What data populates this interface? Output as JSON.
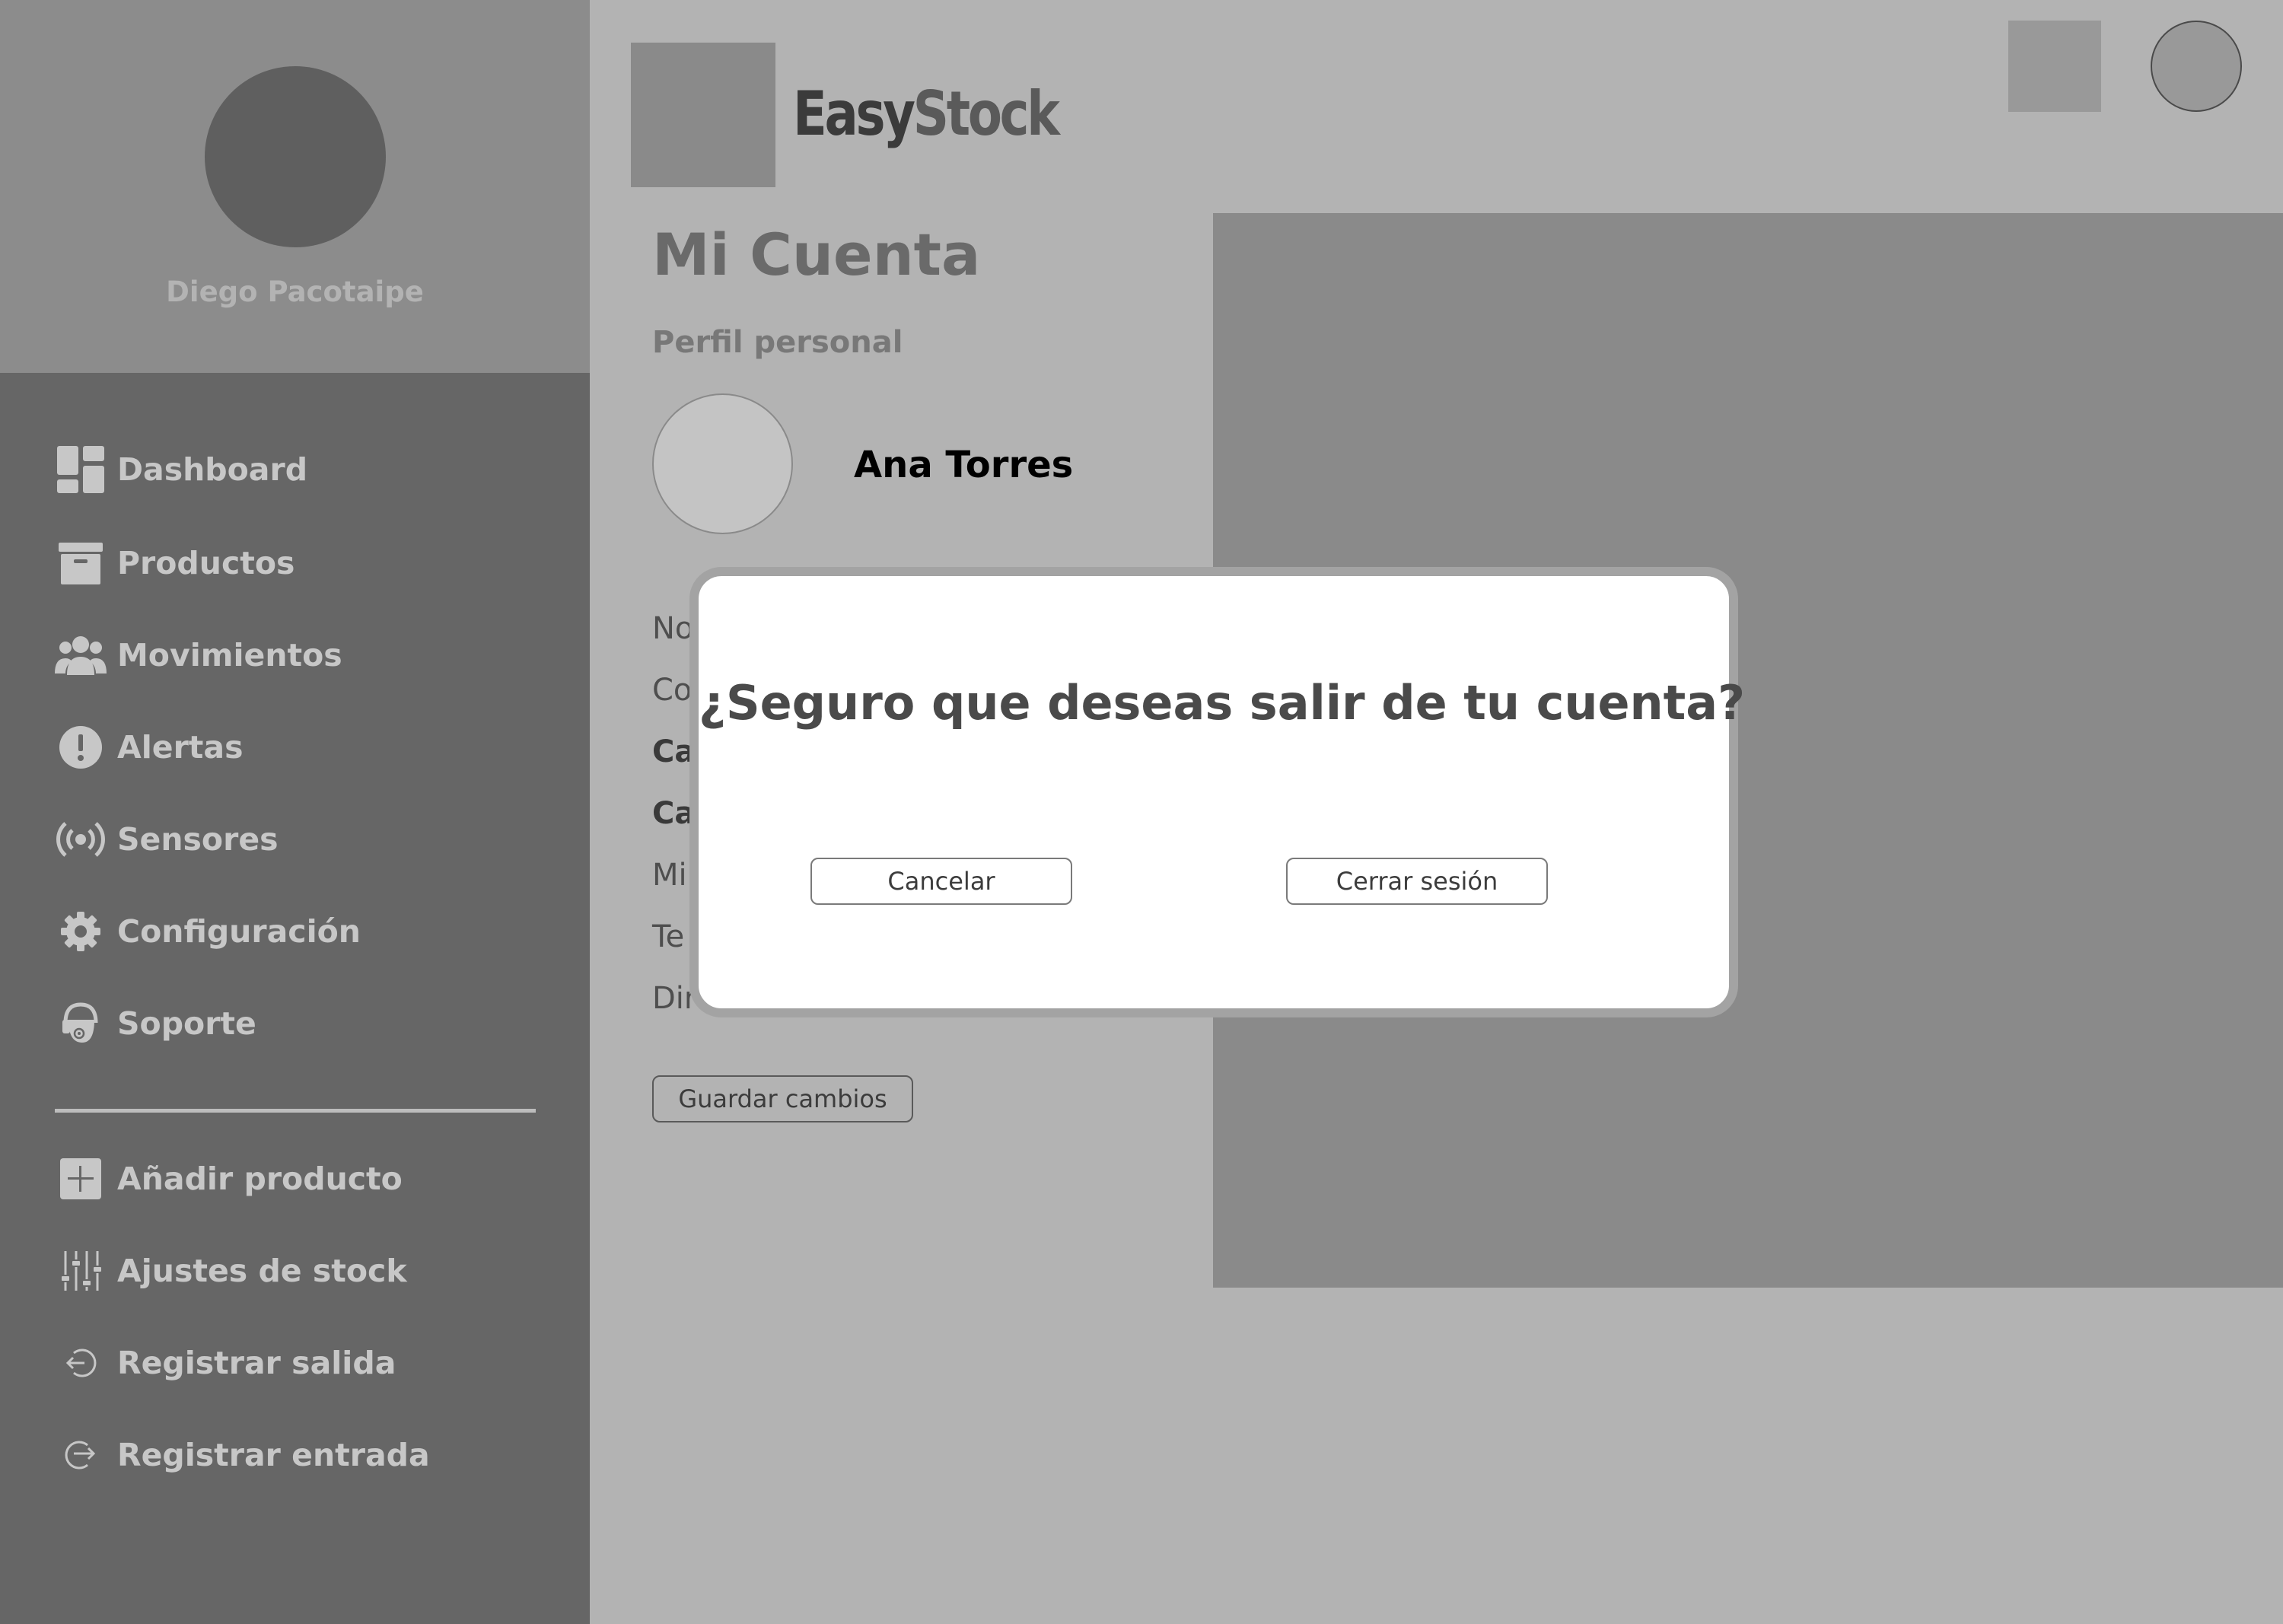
{
  "sidebar": {
    "user_name": "Diego Pacotaipe",
    "items": [
      {
        "label": "Dashboard",
        "icon": "dashboard-icon"
      },
      {
        "label": "Productos",
        "icon": "archive-box-icon"
      },
      {
        "label": "Movimientos",
        "icon": "users-icon"
      },
      {
        "label": "Alertas",
        "icon": "alert-icon"
      },
      {
        "label": "Sensores",
        "icon": "broadcast-icon"
      },
      {
        "label": "Configuración",
        "icon": "gear-icon"
      },
      {
        "label": "Soporte",
        "icon": "headset-icon"
      }
    ],
    "actions": [
      {
        "label": "Añadir producto",
        "icon": "plus-square-icon"
      },
      {
        "label": "Ajustes de stock",
        "icon": "sliders-icon"
      },
      {
        "label": "Registrar salida",
        "icon": "exit-icon"
      },
      {
        "label": "Registrar entrada",
        "icon": "enter-icon"
      }
    ]
  },
  "header": {
    "brand_part1": "Easy",
    "brand_part2": "Stock"
  },
  "main": {
    "title": "Mi Cuenta",
    "section_label": "Perfil personal",
    "user_name": "Ana Torres",
    "field_labels": [
      "No",
      "Co",
      "Ca",
      "Ca",
      "Mi",
      "Te",
      "Dir"
    ],
    "save_button": "Guardar cambios"
  },
  "modal": {
    "question": "¿Seguro que deseas salir de tu cuenta?",
    "cancel_button": "Cancelar",
    "confirm_button": "Cerrar sesión"
  },
  "colors": {
    "sidebar_bg": "#666666",
    "profile_bg": "#8c8c8c",
    "page_bg": "#b3b3b3",
    "modal_bg": "#ffffff"
  }
}
